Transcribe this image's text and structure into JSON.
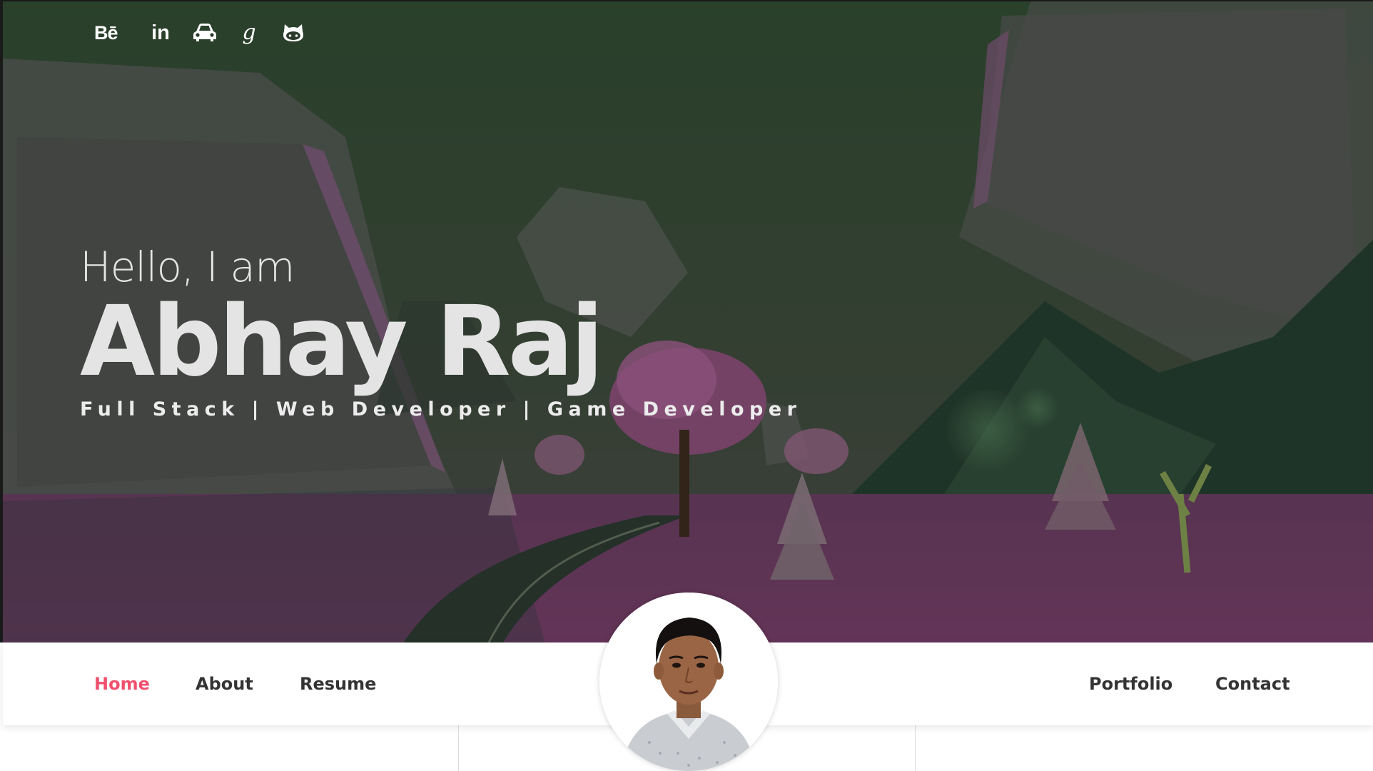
{
  "social": {
    "behance": "Bē",
    "linkedin": "in",
    "google": "g",
    "icons": [
      "behance-icon",
      "linkedin-icon",
      "car-icon",
      "google-icon",
      "github-icon"
    ]
  },
  "intro": {
    "greeting": "Hello, I am",
    "name": "Abhay Raj",
    "tagline": "Full Stack | Web Developer | Game Developer"
  },
  "nav": {
    "home": "Home",
    "about": "About",
    "resume": "Resume",
    "portfolio": "Portfolio",
    "contact": "Contact",
    "active": "Home"
  },
  "colors": {
    "accent": "#f0506e",
    "nav_text": "#333333",
    "hero_text": "#e4e4e4"
  }
}
